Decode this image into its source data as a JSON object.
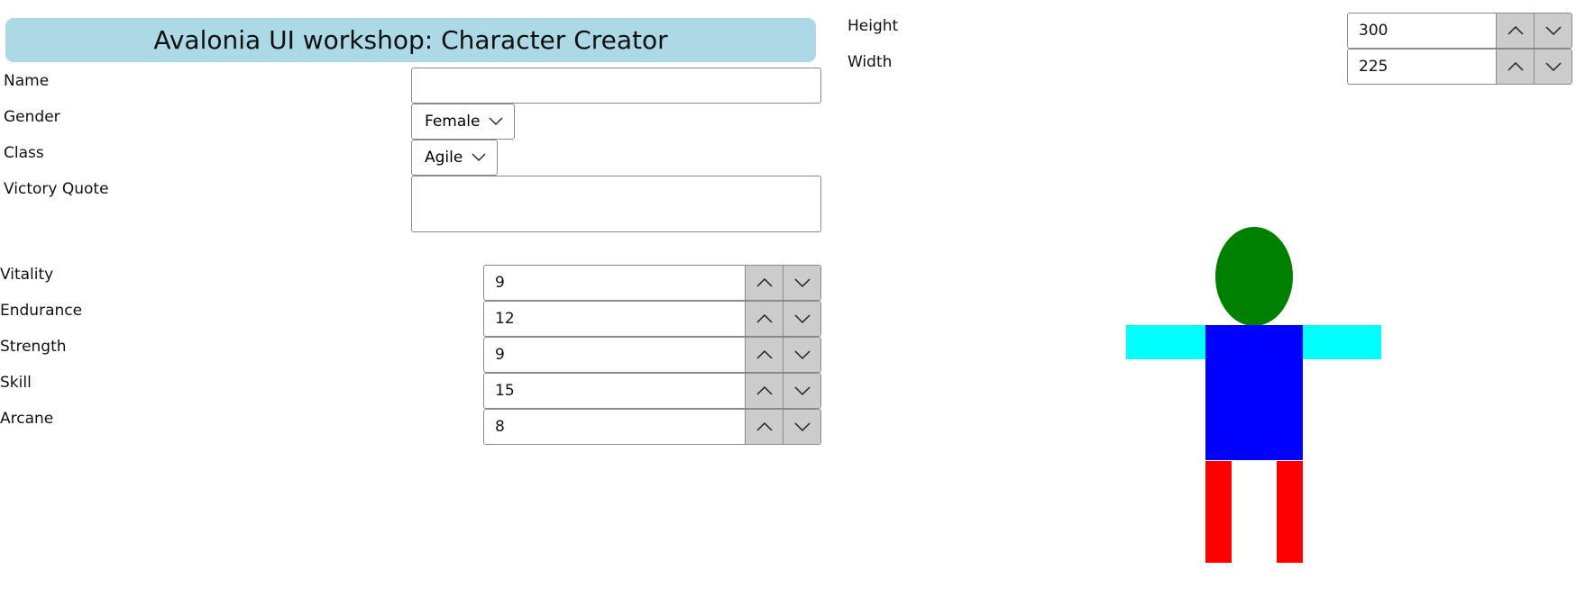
{
  "title": "Avalonia UI workshop: Character Creator",
  "form": {
    "name": {
      "label": "Name",
      "value": "",
      "placeholder": ""
    },
    "gender": {
      "label": "Gender",
      "selected": "Female"
    },
    "class": {
      "label": "Class",
      "selected": "Agile"
    },
    "victory_quote": {
      "label": "Victory Quote",
      "value": ""
    }
  },
  "stats": [
    {
      "label": "Vitality",
      "value": "9"
    },
    {
      "label": "Endurance",
      "value": "12"
    },
    {
      "label": "Strength",
      "value": "9"
    },
    {
      "label": "Skill",
      "value": "15"
    },
    {
      "label": "Arcane",
      "value": "8"
    }
  ],
  "preview": {
    "height": {
      "label": "Height",
      "value": "300"
    },
    "width": {
      "label": "Width",
      "value": "225"
    }
  },
  "icons": {
    "spin_up": "chevron-up-icon",
    "spin_down": "chevron-down-icon",
    "dropdown": "chevron-down-icon"
  },
  "colors": {
    "banner": "#add8e6",
    "spinner": "#cccccc",
    "head": "#008000",
    "arms": "#00ffff",
    "torso": "#0000ff",
    "legs": "#ff0000"
  }
}
